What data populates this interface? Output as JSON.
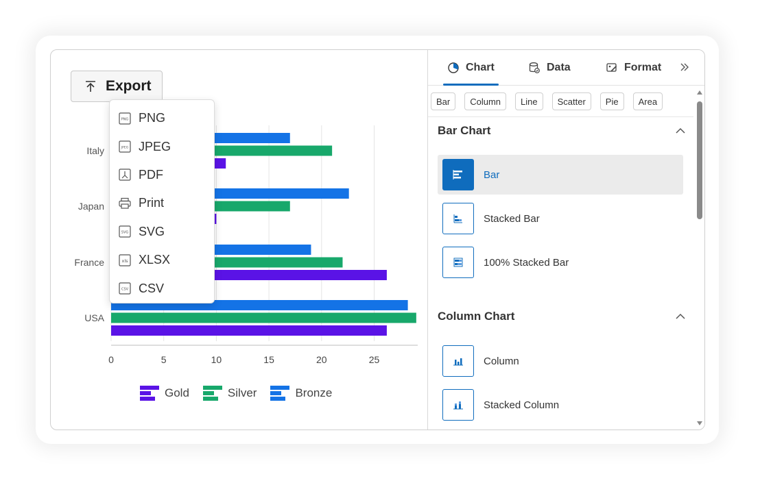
{
  "export": {
    "label": "Export",
    "menu": [
      {
        "label": "PNG",
        "icon": "png-file-icon"
      },
      {
        "label": "JPEG",
        "icon": "jpeg-file-icon"
      },
      {
        "label": "PDF",
        "icon": "pdf-file-icon"
      },
      {
        "label": "Print",
        "icon": "printer-icon"
      },
      {
        "label": "SVG",
        "icon": "svg-file-icon"
      },
      {
        "label": "XLSX",
        "icon": "xlsx-file-icon"
      },
      {
        "label": "CSV",
        "icon": "csv-file-icon"
      }
    ]
  },
  "chart_data": {
    "type": "bar",
    "orientation": "horizontal",
    "categories": [
      "USA",
      "France",
      "Japan",
      "Italy"
    ],
    "series": [
      {
        "name": "Gold",
        "color": "#5a13e6",
        "values": [
          26.2,
          26.2,
          10,
          10.9
        ]
      },
      {
        "name": "Silver",
        "color": "#18a86b",
        "values": [
          29,
          22,
          17,
          21
        ]
      },
      {
        "name": "Bronze",
        "color": "#1473e6",
        "values": [
          28.2,
          19,
          22.6,
          17
        ]
      }
    ],
    "x_ticks": [
      0,
      5,
      10,
      15,
      20,
      25
    ],
    "xlim": [
      0,
      29
    ],
    "grid": true,
    "legend": "bottom"
  },
  "panel": {
    "tabs": [
      {
        "label": "Chart",
        "icon": "pie-chart-icon",
        "active": true
      },
      {
        "label": "Data",
        "icon": "database-icon",
        "active": false
      },
      {
        "label": "Format",
        "icon": "format-brush-icon",
        "active": false
      }
    ],
    "chips": [
      "Bar",
      "Column",
      "Line",
      "Scatter",
      "Pie",
      "Area"
    ],
    "sections": [
      {
        "title": "Bar Chart",
        "options": [
          {
            "label": "Bar",
            "selected": true
          },
          {
            "label": "Stacked Bar",
            "selected": false
          },
          {
            "label": "100% Stacked Bar",
            "selected": false
          }
        ]
      },
      {
        "title": "Column Chart",
        "options": [
          {
            "label": "Column",
            "selected": false
          },
          {
            "label": "Stacked Column",
            "selected": false
          }
        ]
      }
    ]
  },
  "colors": {
    "accent": "#0f6cbd"
  }
}
